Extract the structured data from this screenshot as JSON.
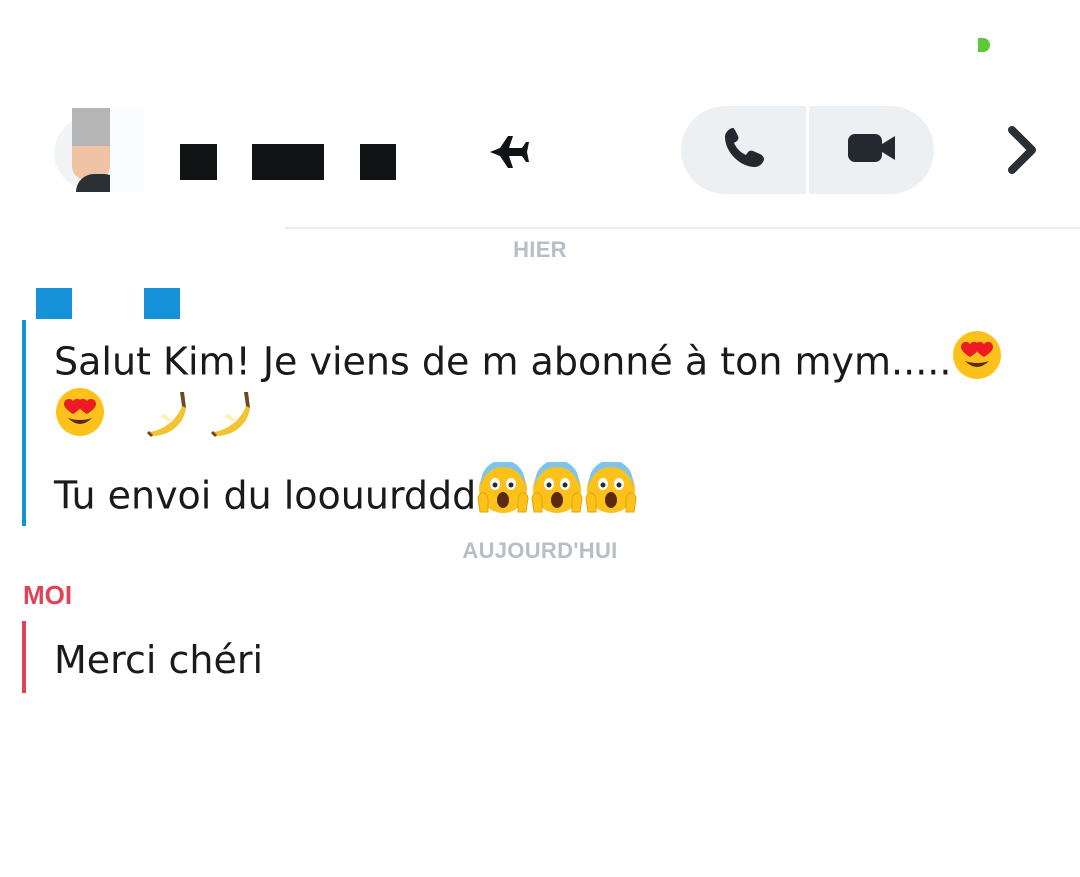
{
  "status": {
    "indicator_color": "#5cc93b"
  },
  "header": {
    "contact_name_redacted": true,
    "avatar": "bitmoji-avatar",
    "status_icon": "airplane-icon",
    "actions": [
      {
        "name": "phone-call",
        "icon": "phone-icon"
      },
      {
        "name": "video-call",
        "icon": "video-camera-icon"
      }
    ],
    "more_icon": "chevron-right-icon"
  },
  "conversation": {
    "date_separators": {
      "yesterday": "HIER",
      "today": "AUJOURD'HUI"
    },
    "incoming": {
      "sender_name_redacted": true,
      "accent_color": "#1592d8",
      "lines": [
        "Salut Kim! Je viens de m abonné à ton mym.....",
        "",
        "Tu envoi du loouurddd"
      ],
      "emojis": {
        "line1": [
          "heart-eyes-emoji"
        ],
        "line2": [
          "heart-eyes-emoji",
          "banana-emoji",
          "banana-emoji"
        ],
        "line3": [
          "screaming-face-emoji",
          "screaming-face-emoji",
          "screaming-face-emoji"
        ]
      }
    },
    "outgoing": {
      "sender_label": "MOI",
      "accent_color": "#e04357",
      "text": "Merci chéri"
    }
  }
}
